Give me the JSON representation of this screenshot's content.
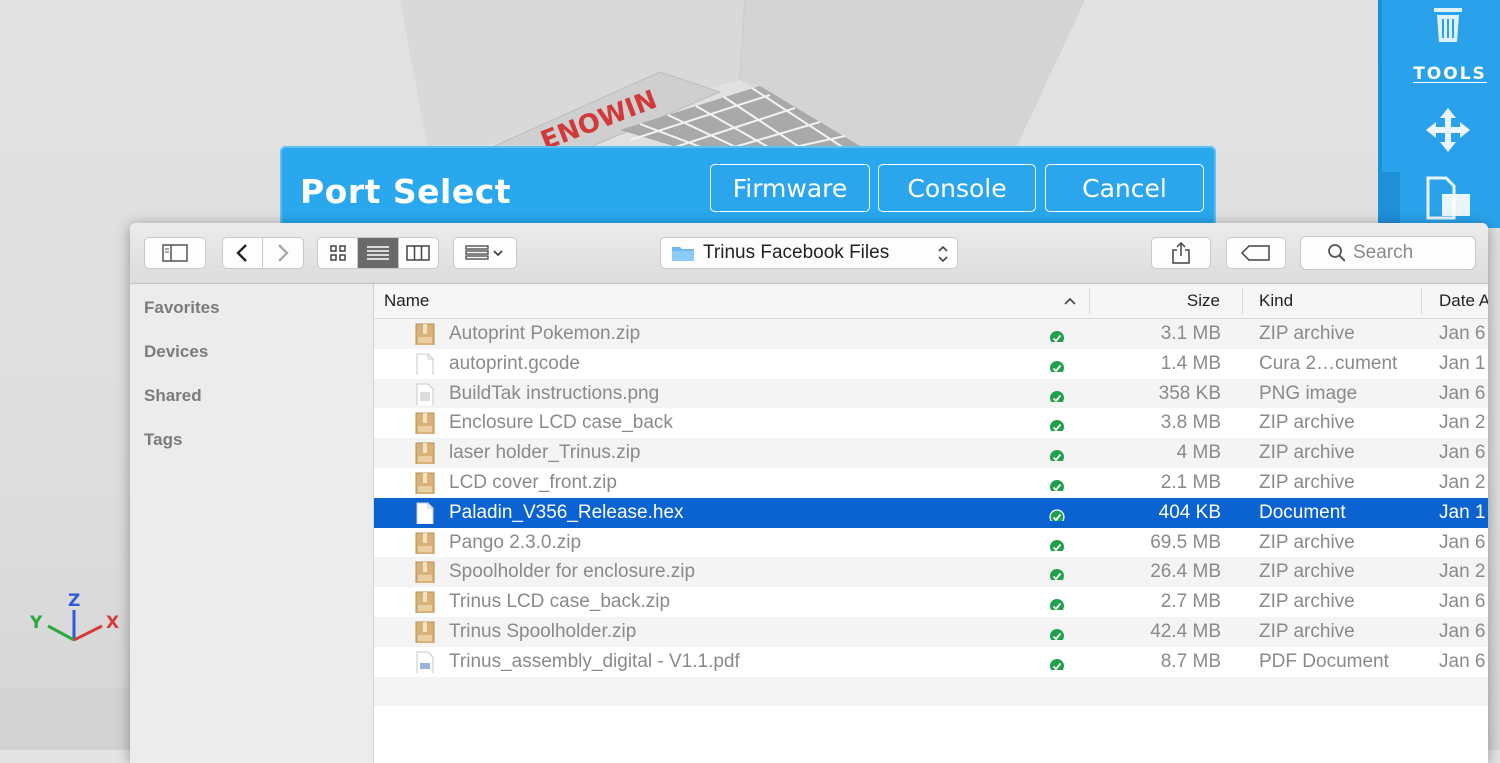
{
  "sidebar_tools": {
    "label": "TOOLS"
  },
  "port_dialog": {
    "title": "Port Select",
    "buttons": [
      "Firmware",
      "Console",
      "Cancel"
    ]
  },
  "finder": {
    "path": "Trinus Facebook Files",
    "search_placeholder": "Search",
    "sidebar": [
      "Favorites",
      "Devices",
      "Shared",
      "Tags"
    ],
    "columns": {
      "name": "Name",
      "size": "Size",
      "kind": "Kind",
      "date": "Date A"
    },
    "selected_index": 6,
    "files": [
      {
        "name": "Autoprint Pokemon.zip",
        "size": "3.1 MB",
        "kind": "ZIP archive",
        "date": "Jan 6",
        "icon": "zip-icon"
      },
      {
        "name": "autoprint.gcode",
        "size": "1.4 MB",
        "kind": "Cura 2…cument",
        "date": "Jan 1",
        "icon": "document-icon"
      },
      {
        "name": "BuildTak instructions.png",
        "size": "358 KB",
        "kind": "PNG image",
        "date": "Jan 6",
        "icon": "image-icon"
      },
      {
        "name": "Enclosure LCD case_back",
        "size": "3.8 MB",
        "kind": "ZIP archive",
        "date": "Jan 2",
        "icon": "zip-icon"
      },
      {
        "name": "laser holder_Trinus.zip",
        "size": "4 MB",
        "kind": "ZIP archive",
        "date": "Jan 6",
        "icon": "zip-icon"
      },
      {
        "name": "LCD cover_front.zip",
        "size": "2.1 MB",
        "kind": "ZIP archive",
        "date": "Jan 2",
        "icon": "zip-icon"
      },
      {
        "name": "Paladin_V356_Release.hex",
        "size": "404 KB",
        "kind": "Document",
        "date": "Jan 1",
        "icon": "document-icon"
      },
      {
        "name": "Pango 2.3.0.zip",
        "size": "69.5 MB",
        "kind": "ZIP archive",
        "date": "Jan 6",
        "icon": "zip-icon"
      },
      {
        "name": "Spoolholder for enclosure.zip",
        "size": "26.4 MB",
        "kind": "ZIP archive",
        "date": "Jan 2",
        "icon": "zip-icon"
      },
      {
        "name": "Trinus LCD case_back.zip",
        "size": "2.7 MB",
        "kind": "ZIP archive",
        "date": "Jan 6",
        "icon": "zip-icon"
      },
      {
        "name": "Trinus Spoolholder.zip",
        "size": "42.4 MB",
        "kind": "ZIP archive",
        "date": "Jan 6",
        "icon": "zip-icon"
      },
      {
        "name": "Trinus_assembly_digital - V1.1.pdf",
        "size": "8.7 MB",
        "kind": "PDF Document",
        "date": "Jan 6",
        "icon": "pdf-icon"
      }
    ]
  },
  "viewport": {
    "printer_brand": "ENOWIN",
    "axes": [
      "X",
      "Y",
      "Z"
    ]
  },
  "colors": {
    "accent": "#2aa8ee",
    "selection": "#0b63d1",
    "check": "#1fa14a"
  }
}
